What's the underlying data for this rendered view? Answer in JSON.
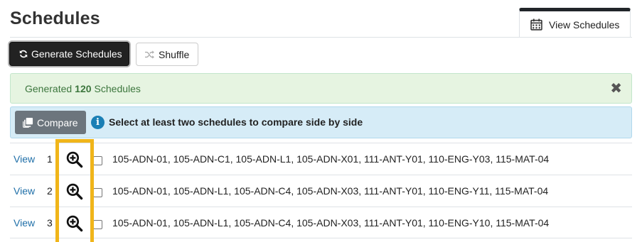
{
  "page": {
    "title": "Schedules"
  },
  "tabs": {
    "view_schedules": "View Schedules"
  },
  "toolbar": {
    "generate_label": "Generate Schedules",
    "shuffle_label": "Shuffle"
  },
  "success_alert": {
    "prefix": "Generated",
    "count": "120",
    "suffix": "Schedules",
    "close": "✖"
  },
  "compare": {
    "button_label": "Compare",
    "info_icon": "i",
    "message": "Select at least two schedules to compare side by side"
  },
  "schedules": [
    {
      "view": "View",
      "index": "1",
      "courses": "105-ADN-01, 105-ADN-C1, 105-ADN-L1, 105-ADN-X01, 111-ANT-Y01, 110-ENG-Y03, 115-MAT-04"
    },
    {
      "view": "View",
      "index": "2",
      "courses": "105-ADN-01, 105-ADN-L1, 105-ADN-C4, 105-ADN-X03, 111-ANT-Y01, 110-ENG-Y11, 115-MAT-04"
    },
    {
      "view": "View",
      "index": "3",
      "courses": "105-ADN-01, 105-ADN-L1, 105-ADN-C4, 105-ADN-X03, 111-ANT-Y01, 110-ENG-Y10, 115-MAT-04"
    }
  ],
  "colors": {
    "highlight": "#f0b51a",
    "success_bg": "#e6f4e1",
    "info_bg": "#d6ecf7",
    "link": "#1f6fa8"
  }
}
